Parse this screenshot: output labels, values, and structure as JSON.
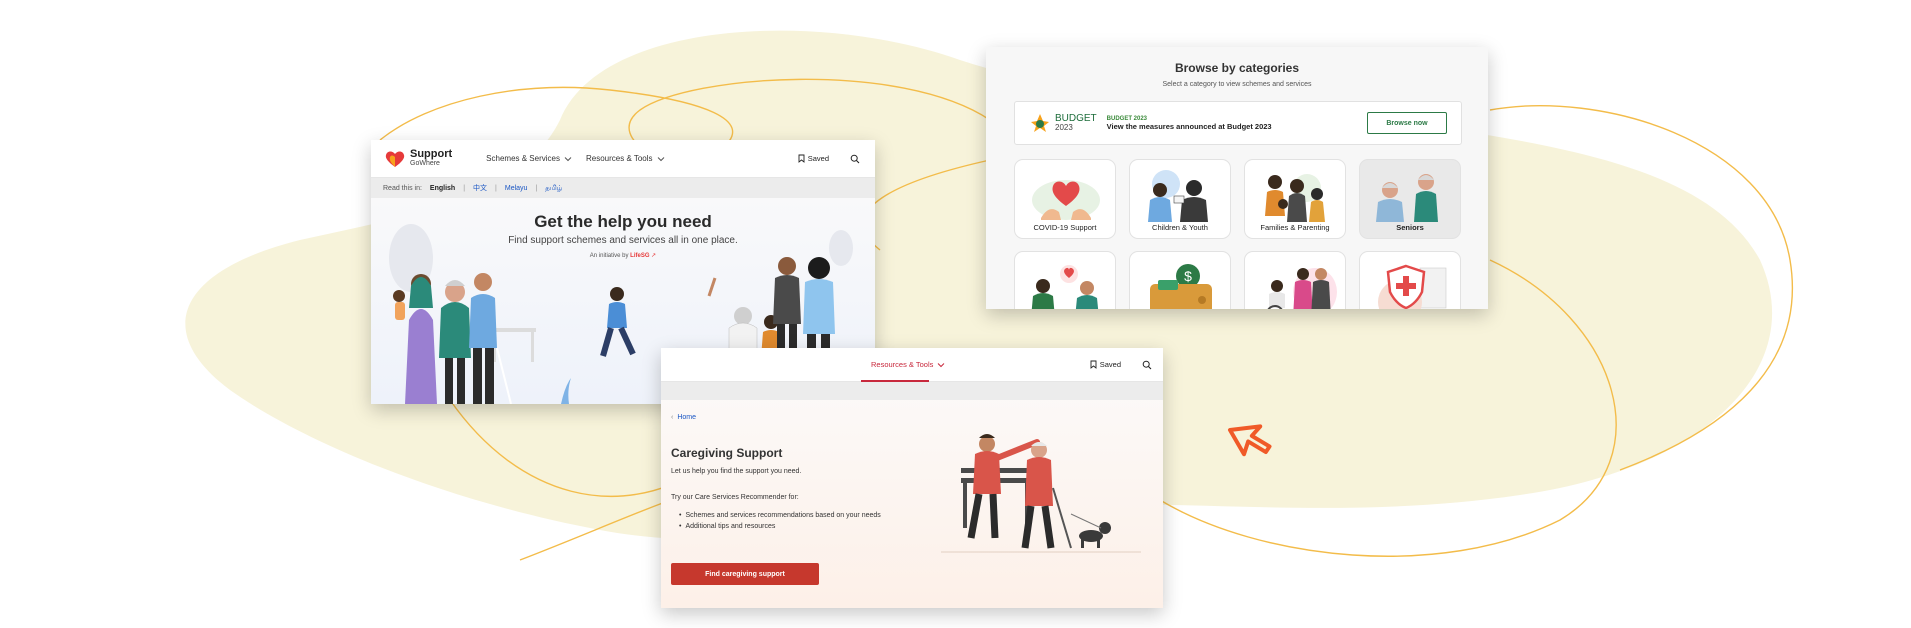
{
  "home": {
    "logo": {
      "line1": "Support",
      "line2": "GoWhere"
    },
    "nav": {
      "schemes": "Schemes & Services",
      "resources": "Resources & Tools",
      "saved": "Saved"
    },
    "language": {
      "label": "Read this in:",
      "options": [
        "English",
        "中文",
        "Melayu",
        "தமிழ்"
      ]
    },
    "hero": {
      "title": "Get the help you need",
      "subtitle": "Find support schemes and services all in one place.",
      "initiative_prefix": "An initiative by",
      "initiative_brand": "LifeSG"
    }
  },
  "categories": {
    "title": "Browse by categories",
    "subtitle": "Select a category to view schemes and services",
    "budget": {
      "logo_word": "BUDGET",
      "logo_year": "2023",
      "tag": "BUDGET 2023",
      "description": "View the measures announced at Budget 2023",
      "button": "Browse now"
    },
    "items": [
      {
        "label": "COVID-19 Support",
        "icon": "heart-hands-icon"
      },
      {
        "label": "Children & Youth",
        "icon": "children-icon"
      },
      {
        "label": "Families & Parenting",
        "icon": "family-icon"
      },
      {
        "label": "Seniors",
        "icon": "seniors-icon",
        "selected": true
      },
      {
        "label": "",
        "icon": "mental-health-icon"
      },
      {
        "label": "",
        "icon": "wallet-money-icon"
      },
      {
        "label": "",
        "icon": "disability-icon"
      },
      {
        "label": "",
        "icon": "health-shield-icon"
      }
    ]
  },
  "care": {
    "nav": {
      "resources": "Resources & Tools",
      "saved": "Saved"
    },
    "breadcrumb": "Home",
    "title": "Caregiving Support",
    "intro": "Let us help you find the support you need.",
    "recommender": "Try our Care Services Recommender for:",
    "bullets": [
      "Schemes and services recommendations based on your needs",
      "Additional tips and resources"
    ],
    "button": "Find caregiving support"
  },
  "colors": {
    "blob": "#f7f3da",
    "line": "#f3bc4a",
    "cursor": "#f05a28",
    "brand_red": "#c6382d",
    "link_blue": "#1a56c4",
    "budget_green": "#2c7a46"
  }
}
